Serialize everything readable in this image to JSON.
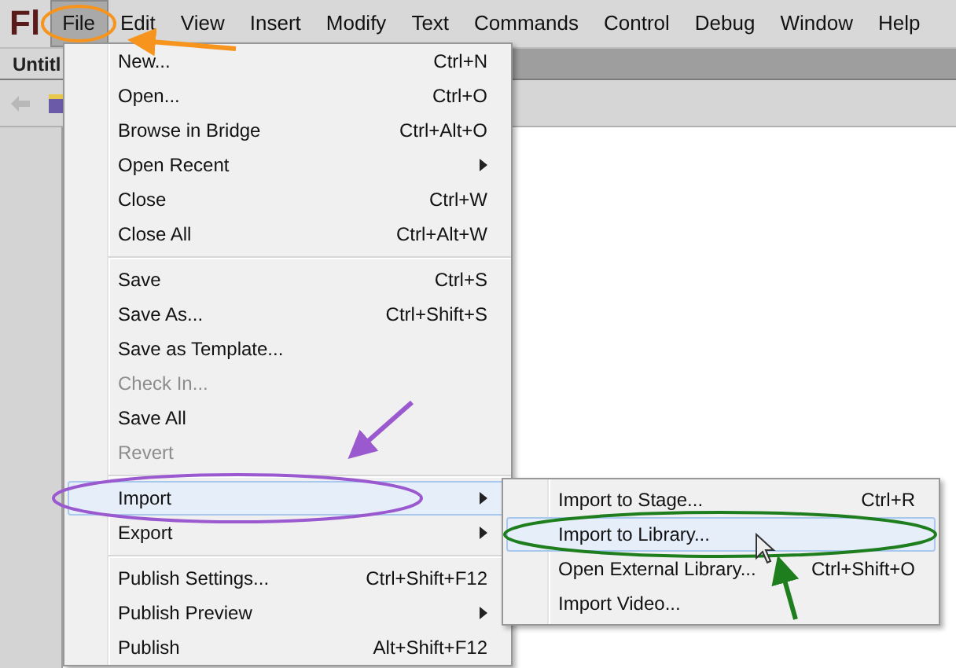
{
  "app_logo": "Fl",
  "menubar": [
    {
      "label": "File",
      "selected": true
    },
    {
      "label": "Edit",
      "selected": false
    },
    {
      "label": "View",
      "selected": false
    },
    {
      "label": "Insert",
      "selected": false
    },
    {
      "label": "Modify",
      "selected": false
    },
    {
      "label": "Text",
      "selected": false
    },
    {
      "label": "Commands",
      "selected": false
    },
    {
      "label": "Control",
      "selected": false
    },
    {
      "label": "Debug",
      "selected": false
    },
    {
      "label": "Window",
      "selected": false
    },
    {
      "label": "Help",
      "selected": false
    }
  ],
  "document_tab": {
    "label": "Untitl"
  },
  "file_menu": [
    {
      "kind": "item",
      "label": "New...",
      "shortcut": "Ctrl+N",
      "disabled": false,
      "submenu": false,
      "selected": false
    },
    {
      "kind": "item",
      "label": "Open...",
      "shortcut": "Ctrl+O",
      "disabled": false,
      "submenu": false,
      "selected": false
    },
    {
      "kind": "item",
      "label": "Browse in Bridge",
      "shortcut": "Ctrl+Alt+O",
      "disabled": false,
      "submenu": false,
      "selected": false
    },
    {
      "kind": "item",
      "label": "Open Recent",
      "disabled": false,
      "submenu": true,
      "selected": false
    },
    {
      "kind": "item",
      "label": "Close",
      "shortcut": "Ctrl+W",
      "disabled": false,
      "submenu": false,
      "selected": false
    },
    {
      "kind": "item",
      "label": "Close All",
      "shortcut": "Ctrl+Alt+W",
      "disabled": false,
      "submenu": false,
      "selected": false
    },
    {
      "kind": "separator"
    },
    {
      "kind": "item",
      "label": "Save",
      "shortcut": "Ctrl+S",
      "disabled": false,
      "submenu": false,
      "selected": false
    },
    {
      "kind": "item",
      "label": "Save As...",
      "shortcut": "Ctrl+Shift+S",
      "disabled": false,
      "submenu": false,
      "selected": false
    },
    {
      "kind": "item",
      "label": "Save as Template...",
      "disabled": false,
      "submenu": false,
      "selected": false
    },
    {
      "kind": "item",
      "label": "Check In...",
      "disabled": true,
      "submenu": false,
      "selected": false
    },
    {
      "kind": "item",
      "label": "Save All",
      "disabled": false,
      "submenu": false,
      "selected": false
    },
    {
      "kind": "item",
      "label": "Revert",
      "disabled": true,
      "submenu": false,
      "selected": false
    },
    {
      "kind": "separator"
    },
    {
      "kind": "item",
      "label": "Import",
      "disabled": false,
      "submenu": true,
      "selected": true
    },
    {
      "kind": "item",
      "label": "Export",
      "disabled": false,
      "submenu": true,
      "selected": false
    },
    {
      "kind": "separator"
    },
    {
      "kind": "item",
      "label": "Publish Settings...",
      "shortcut": "Ctrl+Shift+F12",
      "disabled": false,
      "submenu": false,
      "selected": false
    },
    {
      "kind": "item",
      "label": "Publish Preview",
      "disabled": false,
      "submenu": true,
      "selected": false
    },
    {
      "kind": "item",
      "label": "Publish",
      "shortcut": "Alt+Shift+F12",
      "disabled": false,
      "submenu": false,
      "selected": false
    }
  ],
  "import_submenu": [
    {
      "label": "Import to Stage...",
      "shortcut": "Ctrl+R",
      "selected": false
    },
    {
      "label": "Import to Library...",
      "selected": true
    },
    {
      "label": "Open External Library...",
      "shortcut": "Ctrl+Shift+O",
      "selected": false
    },
    {
      "label": "Import Video...",
      "selected": false
    }
  ]
}
